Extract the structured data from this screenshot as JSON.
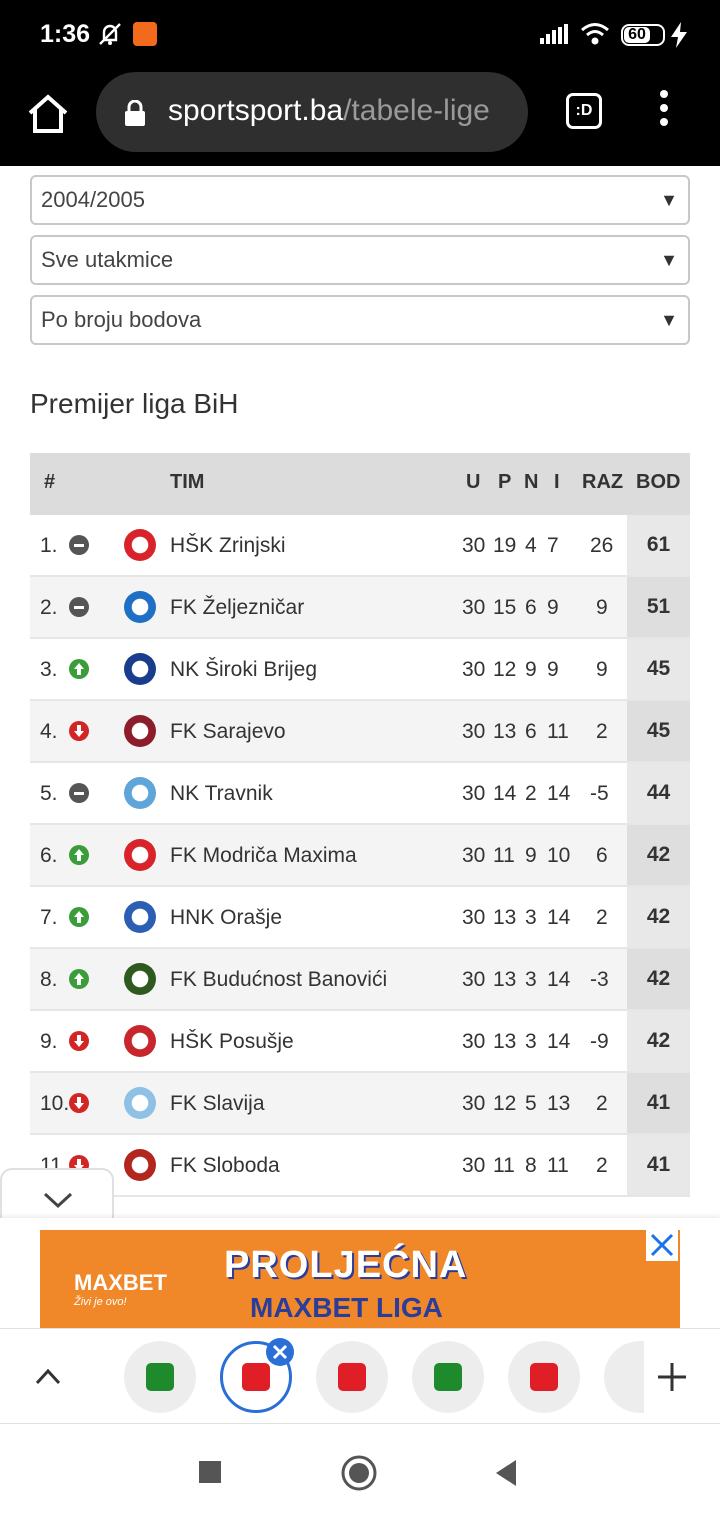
{
  "status_bar": {
    "time": "1:36",
    "battery": "60"
  },
  "browser": {
    "url_host": "sportsport.ba",
    "url_path": "/tabele-lige",
    "tab_label": ":D"
  },
  "filters": {
    "season": "2004/2005",
    "matches": "Sve utakmice",
    "sort": "Po broju bodova",
    "arrow": "▼"
  },
  "league_title": "Premijer liga BiH",
  "table": {
    "headers": {
      "rank": "#",
      "team": "TIM",
      "played": "U",
      "won": "P",
      "draw": "N",
      "lost": "I",
      "diff": "RAZ",
      "points": "BOD"
    },
    "rows": [
      {
        "rank": "1.",
        "trend": "same",
        "team": "HŠK Zrinjski",
        "played": "30",
        "won": "19",
        "draw": "4",
        "lost": "7",
        "diff": "26",
        "points": "61",
        "logo": "#d8232a"
      },
      {
        "rank": "2.",
        "trend": "same",
        "team": "FK Željezničar",
        "played": "30",
        "won": "15",
        "draw": "6",
        "lost": "9",
        "diff": "9",
        "points": "51",
        "logo": "#1f6fc4"
      },
      {
        "rank": "3.",
        "trend": "up",
        "team": "NK Široki Brijeg",
        "played": "30",
        "won": "12",
        "draw": "9",
        "lost": "9",
        "diff": "9",
        "points": "45",
        "logo": "#1a3c8c"
      },
      {
        "rank": "4.",
        "trend": "down",
        "team": "FK Sarajevo",
        "played": "30",
        "won": "13",
        "draw": "6",
        "lost": "11",
        "diff": "2",
        "points": "45",
        "logo": "#8c1d2a"
      },
      {
        "rank": "5.",
        "trend": "same",
        "team": "NK Travnik",
        "played": "30",
        "won": "14",
        "draw": "2",
        "lost": "14",
        "diff": "-5",
        "points": "44",
        "logo": "#5fa5d9"
      },
      {
        "rank": "6.",
        "trend": "up",
        "team": "FK Modriča Maxima",
        "played": "30",
        "won": "11",
        "draw": "9",
        "lost": "10",
        "diff": "6",
        "points": "42",
        "logo": "#d8232a"
      },
      {
        "rank": "7.",
        "trend": "up",
        "team": "HNK Orašje",
        "played": "30",
        "won": "13",
        "draw": "3",
        "lost": "14",
        "diff": "2",
        "points": "42",
        "logo": "#2b5fb3"
      },
      {
        "rank": "8.",
        "trend": "up",
        "team": "FK Budućnost Banovići",
        "played": "30",
        "won": "13",
        "draw": "3",
        "lost": "14",
        "diff": "-3",
        "points": "42",
        "logo": "#2e5a1f"
      },
      {
        "rank": "9.",
        "trend": "down",
        "team": "HŠK Posušje",
        "played": "30",
        "won": "13",
        "draw": "3",
        "lost": "14",
        "diff": "-9",
        "points": "42",
        "logo": "#c8262d"
      },
      {
        "rank": "10.",
        "trend": "down",
        "team": "FK Slavija",
        "played": "30",
        "won": "12",
        "draw": "5",
        "lost": "13",
        "diff": "2",
        "points": "41",
        "logo": "#8fc0e6"
      },
      {
        "rank": "11.",
        "trend": "down",
        "team": "FK Sloboda",
        "played": "30",
        "won": "11",
        "draw": "8",
        "lost": "11",
        "diff": "2",
        "points": "41",
        "logo": "#b3261e"
      }
    ]
  },
  "ad": {
    "title": "PROLJEĆNA",
    "subtitle": "MAXBET LIGA",
    "brand": "MAXBET",
    "tagline": "Živi je ovo!"
  },
  "colors": {
    "accent": "#2a6fd6",
    "ad_bg": "#f0882a",
    "up": "#3a9d3a",
    "down": "#d22626",
    "same": "#555555"
  }
}
